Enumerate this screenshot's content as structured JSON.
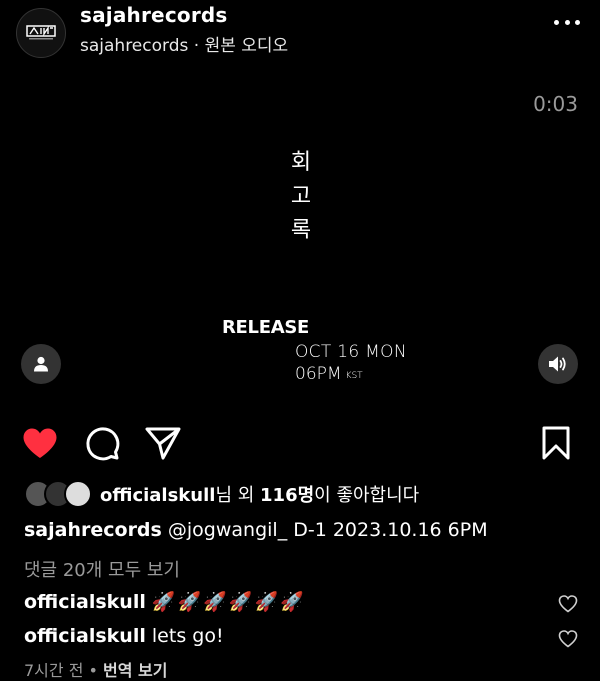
{
  "post": {
    "username": "sajahrecords",
    "subtitle_user": "sajahrecords",
    "subtitle_sep": " · ",
    "subtitle_audio": "원본 오디오"
  },
  "video": {
    "timer": "0:03",
    "title_chars": [
      "회",
      "고",
      "록"
    ],
    "release": "RELEASE",
    "date_line1": "OCT 16 MON",
    "date_line2": "06PM",
    "tz": "KST"
  },
  "likes": {
    "user": "officialskull",
    "suffix1": "님 외 ",
    "count": "116명",
    "suffix2": "이 좋아합니다"
  },
  "caption": {
    "user": "sajahrecords",
    "text": " @jogwangil_  D-1 2023.10.16 6PM"
  },
  "comments_link": "댓글 20개 모두 보기",
  "comments": [
    {
      "user": "officialskull",
      "text": "🚀🚀🚀🚀🚀🚀"
    },
    {
      "user": "officialskull",
      "text": "lets go!"
    }
  ],
  "meta": {
    "time": "7시간 전",
    "sep": " • ",
    "translate": "번역 보기"
  },
  "colors": {
    "like_red": "#ff3040",
    "muted": "#9a9a9a"
  },
  "icons": [
    "more-icon",
    "user-icon",
    "volume-icon",
    "heart-icon",
    "comment-icon",
    "share-icon",
    "bookmark-icon"
  ]
}
